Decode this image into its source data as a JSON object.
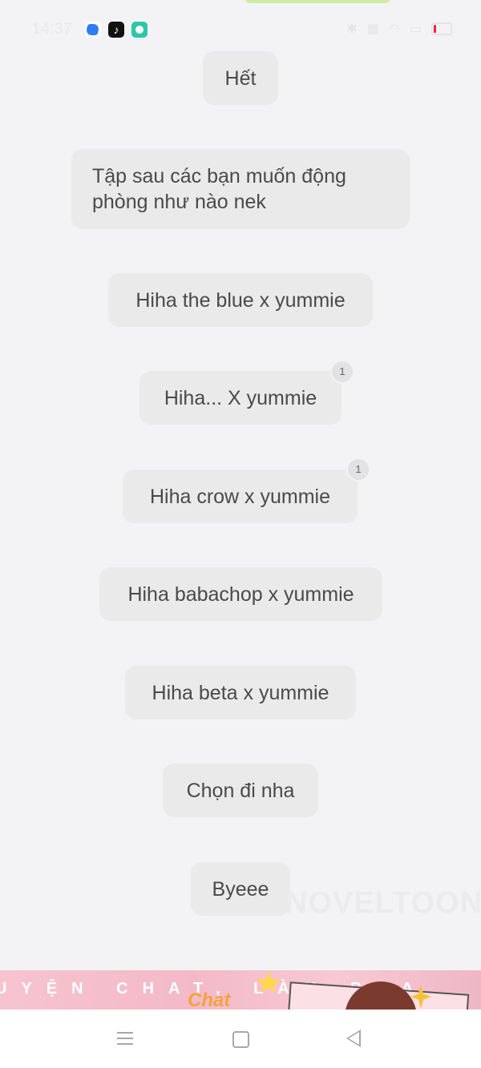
{
  "status_bar": {
    "time": "14:37",
    "app_icons": [
      "notes-icon",
      "tiktok-icon",
      "chat-app-icon"
    ],
    "tiktok_glyph": "♪"
  },
  "messages": [
    {
      "text": "Hết"
    },
    {
      "text": "Tập sau các bạn muốn động phòng như nào nek"
    },
    {
      "text": "Hiha the blue x yummie"
    },
    {
      "text": "Hiha... X yummie",
      "badge": "1"
    },
    {
      "text": "Hiha crow x yummie",
      "badge": "1"
    },
    {
      "text": "Hiha babachop x yummie"
    },
    {
      "text": "Hiha beta x yummie"
    },
    {
      "text": "Chọn đi nha"
    },
    {
      "text": "Byeee"
    }
  ],
  "watermark": "NOVELTOON",
  "banner": {
    "text": "UYỆN CHAT, LÀM PHA",
    "logo": "Chat"
  },
  "colors": {
    "background": "#f3f3f5",
    "bubble": "#eaeaeb",
    "banner": "#f4b9c8"
  }
}
